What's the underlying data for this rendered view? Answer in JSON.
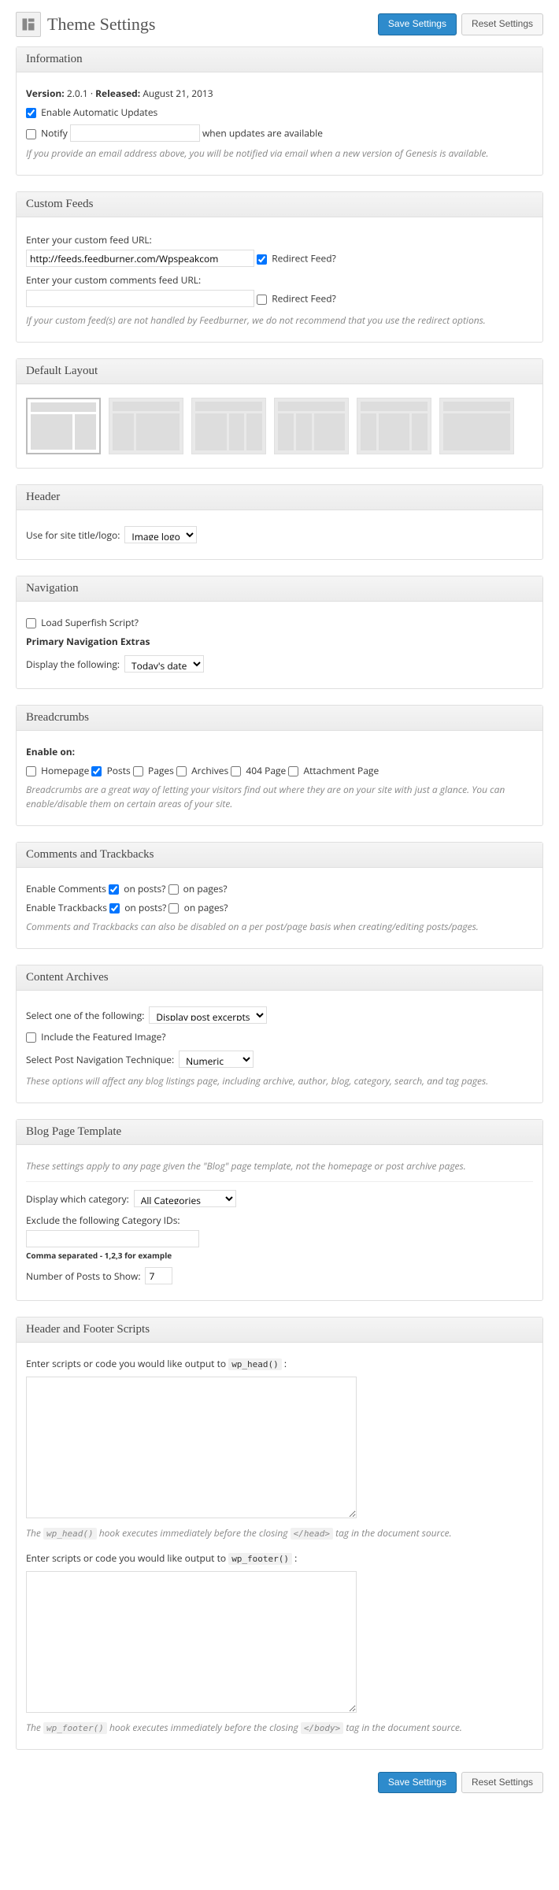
{
  "page": {
    "title": "Theme Settings"
  },
  "buttons": {
    "save": "Save Settings",
    "reset": "Reset Settings"
  },
  "info": {
    "title": "Information",
    "version_label": "Version:",
    "version": "2.0.1",
    "released_label": "Released:",
    "released": "August 21, 2013",
    "updates_label": "Enable Automatic Updates",
    "notify_label": "Notify",
    "notify_suffix": "when updates are available",
    "desc": "If you provide an email address above, you will be notified via email when a new version of Genesis is available."
  },
  "feeds": {
    "title": "Custom Feeds",
    "feed_label": "Enter your custom feed URL:",
    "feed_value": "http://feeds.feedburner.com/Wpspeakcom",
    "redirect_label": "Redirect Feed?",
    "comments_label": "Enter your custom comments feed URL:",
    "desc": "If your custom feed(s) are not handled by Feedburner, we do not recommend that you use the redirect options."
  },
  "layout": {
    "title": "Default Layout"
  },
  "header": {
    "title": "Header",
    "label": "Use for site title/logo:",
    "value": "Image logo"
  },
  "nav": {
    "title": "Navigation",
    "superfish": "Load Superfish Script?",
    "extras_heading": "Primary Navigation Extras",
    "display_label": "Display the following:",
    "display_value": "Today's date"
  },
  "breadcrumbs": {
    "title": "Breadcrumbs",
    "enable_label": "Enable on:",
    "homepage": "Homepage",
    "posts": "Posts",
    "pages": "Pages",
    "archives": "Archives",
    "p404": "404 Page",
    "attachment": "Attachment Page",
    "desc": "Breadcrumbs are a great way of letting your visitors find out where they are on your site with just a glance. You can enable/disable them on certain areas of your site."
  },
  "comments": {
    "title": "Comments and Trackbacks",
    "enable_comments": "Enable Comments",
    "enable_trackbacks": "Enable Trackbacks",
    "on_posts": "on posts?",
    "on_pages": "on pages?",
    "desc": "Comments and Trackbacks can also be disabled on a per post/page basis when creating/editing posts/pages."
  },
  "archives": {
    "title": "Content Archives",
    "select_label": "Select one of the following:",
    "select_value": "Display post excerpts",
    "featured_label": "Include the Featured Image?",
    "nav_label": "Select Post Navigation Technique:",
    "nav_value": "Numeric",
    "desc": "These options will affect any blog listings page, including archive, author, blog, category, search, and tag pages."
  },
  "blog": {
    "title": "Blog Page Template",
    "desc": "These settings apply to any page given the \"Blog\" page template, not the homepage or post archive pages.",
    "category_label": "Display which category:",
    "category_value": "All Categories",
    "exclude_label": "Exclude the following Category IDs:",
    "exclude_hint": "Comma separated - 1,2,3 for example",
    "posts_label": "Number of Posts to Show:",
    "posts_value": "7"
  },
  "scripts": {
    "title": "Header and Footer Scripts",
    "head_prefix": "Enter scripts or code you would like output to ",
    "head_code": "wp_head()",
    "head_desc_pre": "The ",
    "head_desc_mid": " hook executes immediately before the closing ",
    "head_tag": "</head>",
    "head_desc_post": " tag in the document source.",
    "footer_code": "wp_footer()",
    "footer_tag": "</body>"
  }
}
